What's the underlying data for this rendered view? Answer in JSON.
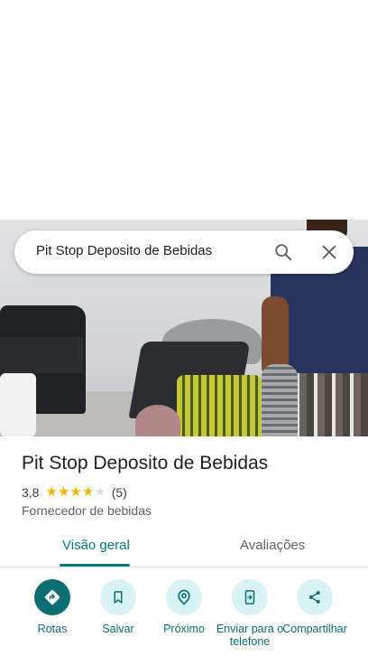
{
  "search": {
    "query": "Pit Stop Deposito de Bebidas"
  },
  "place": {
    "name": "Pit Stop Deposito de Bebidas",
    "rating": "3,8",
    "stars_filled": 4,
    "stars_total": 5,
    "review_count": "(5)",
    "category": "Fornecedor de bebidas"
  },
  "tabs": [
    {
      "label": "Visão geral",
      "selected": true
    },
    {
      "label": "Avaliações",
      "selected": false
    }
  ],
  "actions": [
    {
      "label": "Rotas",
      "icon": "directions-icon"
    },
    {
      "label": "Salvar",
      "icon": "bookmark-icon"
    },
    {
      "label": "Próximo",
      "icon": "nearby-icon"
    },
    {
      "label": "Enviar para o telefone",
      "icon": "send-to-phone-icon"
    },
    {
      "label": "Compartilhar",
      "icon": "share-icon"
    }
  ],
  "colors": {
    "accent": "#0b7a7a",
    "accent_light": "#d8f3f5",
    "star": "#f4b400"
  }
}
